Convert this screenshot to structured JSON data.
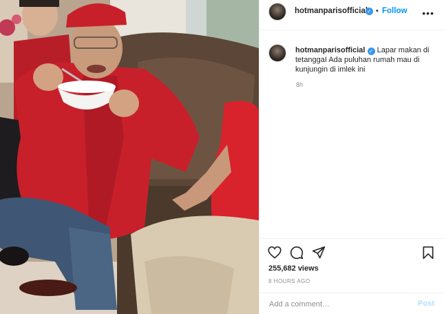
{
  "post": {
    "username": "hotmanparisofficial",
    "verified_icon": "verified-badge-icon",
    "follow_label": "Follow",
    "separator": "•",
    "more_label": "•••"
  },
  "caption": {
    "username": "hotmanparisofficial",
    "text": "Lapar makan di tetanggaI Ada puluhan rumah mau di kunjungin di imlek ini",
    "age": "8h"
  },
  "actions": {
    "like_icon": "heart-icon",
    "comment_icon": "comment-bubble-icon",
    "share_icon": "paper-plane-icon",
    "save_icon": "bookmark-icon"
  },
  "stats": {
    "views": "255,682 views",
    "timestamp": "8 HOURS AGO"
  },
  "comment": {
    "placeholder": "Add a comment…",
    "post_label": "Post"
  },
  "colors": {
    "accent": "#0095f6",
    "verified": "#3897f0",
    "muted": "#8e8e8e",
    "post_disabled": "#b2dffc",
    "shirt_red": "#c8202a"
  }
}
